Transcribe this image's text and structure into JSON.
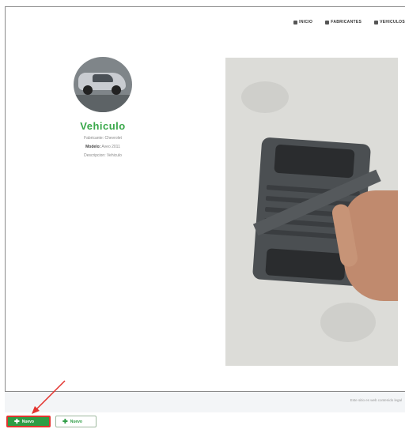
{
  "nav": {
    "items": [
      {
        "label": "INICIO",
        "icon": "home-icon"
      },
      {
        "label": "FABRICANTES",
        "icon": "factory-icon"
      },
      {
        "label": "VEHICULOS",
        "icon": "car-icon"
      }
    ]
  },
  "profile": {
    "title": "Vehiculo",
    "lines": [
      {
        "key": "Fabricante:",
        "value": "Chevrolet"
      },
      {
        "key": "Modelo:",
        "value": "Aveo 2011"
      },
      {
        "key": "Descripcion:",
        "value": "Vehiculo"
      }
    ]
  },
  "footer": {
    "text": "Este sitio es web contenido legal"
  },
  "buttons": {
    "primary_label": "Nuevo",
    "secondary_label": "Nuevo"
  },
  "colors": {
    "accent": "#39a84a",
    "button_green": "#2e9d45",
    "highlight_red": "#e3342f"
  }
}
